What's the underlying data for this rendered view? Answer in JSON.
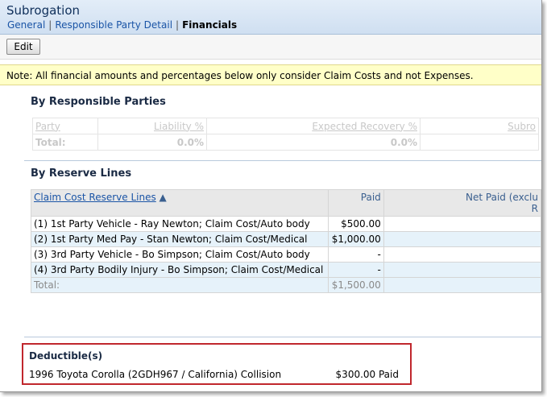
{
  "header": {
    "title": "Subrogation",
    "crumbs": [
      "General",
      "Responsible Party Detail",
      "Financials"
    ]
  },
  "toolbar": {
    "edit_label": "Edit"
  },
  "note": "Note:  All financial amounts and percentages below only consider Claim Costs and not Expenses.",
  "responsible_parties": {
    "title": "By Responsible Parties",
    "columns": [
      "Party",
      "Liability %",
      "Expected Recovery %",
      "Subro"
    ],
    "total_label": "Total:",
    "total_liability": "0.0%",
    "total_recovery": "0.0%"
  },
  "reserve_lines": {
    "title": "By Reserve Lines",
    "columns": [
      "Claim Cost Reserve Lines",
      "Paid",
      "Net Paid (exclu",
      "R"
    ],
    "rows": [
      {
        "name": "(1) 1st Party Vehicle - Ray Newton; Claim Cost/Auto body",
        "paid": "$500.00"
      },
      {
        "name": "(2) 1st Party Med Pay - Stan Newton; Claim Cost/Medical",
        "paid": "$1,000.00"
      },
      {
        "name": "(3) 3rd Party Vehicle - Bo Simpson; Claim Cost/Auto body",
        "paid": "-"
      },
      {
        "name": "(4) 3rd Party Bodily Injury - Bo Simpson; Claim Cost/Medical",
        "paid": "-"
      }
    ],
    "total_label": "Total:",
    "total_paid": "$1,500.00"
  },
  "deductibles": {
    "title": "Deductible(s)",
    "item": "1996 Toyota Corolla (2GDH967 / California) Collision",
    "amount": "$300.00 Paid"
  }
}
